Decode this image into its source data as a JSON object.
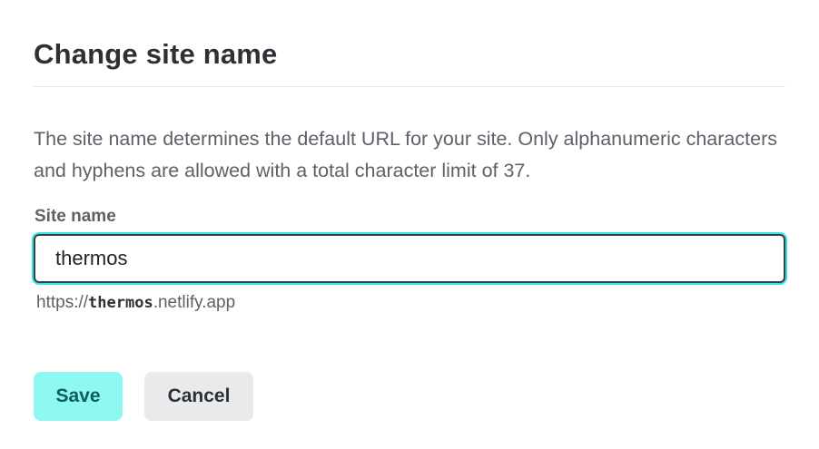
{
  "dialog": {
    "title": "Change site name",
    "description": "The site name determines the default URL for your site. Only alphanumeric characters and hyphens are allowed with a total character limit of 37.",
    "field_label": "Site name",
    "input_value": "thermos",
    "url_preview": {
      "prefix": "https://",
      "site": "thermos",
      "suffix": ".netlify.app"
    },
    "save_label": "Save",
    "cancel_label": "Cancel"
  },
  "colors": {
    "focus_ring": "#32e6e2",
    "save_bg": "#8ef8f2",
    "save_text": "#0c5e61",
    "cancel_bg": "#e9eaec"
  }
}
